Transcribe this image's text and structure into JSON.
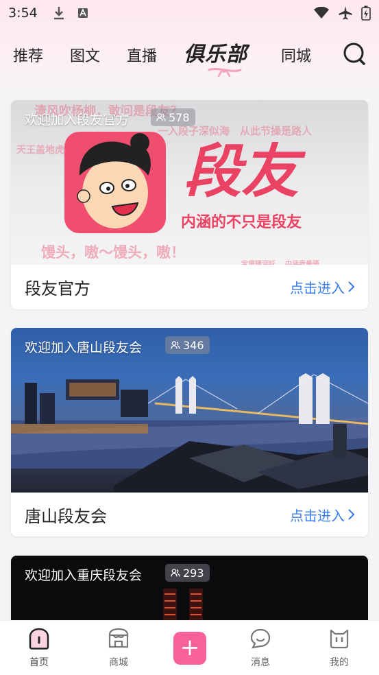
{
  "status_bar": {
    "time": "3:54"
  },
  "nav": {
    "tabs": [
      {
        "label": "推荐"
      },
      {
        "label": "图文"
      },
      {
        "label": "直播"
      },
      {
        "label": "俱乐部",
        "active": true
      },
      {
        "label": "同城"
      }
    ]
  },
  "clubs": [
    {
      "welcome": "欢迎加入段友官方",
      "members": "578",
      "name": "段友官方",
      "enter": "点击进入",
      "banner": {
        "logo_text": "段友",
        "slogan": "内涵的不只是段友",
        "bg_line_1": "清风吹杨柳，敢问是段友？",
        "bg_line_2": "一入段子深似海　从此节操是路人",
        "bg_line_3": "馒头，嗷～馒头，嗷！",
        "bg_line_4": "天王盖地虎",
        "bg_line_5": "宝塔镇河妖",
        "bg_line_6": "内涵我最骚"
      }
    },
    {
      "welcome": "欢迎加入唐山段友会",
      "members": "346",
      "name": "唐山段友会",
      "enter": "点击进入"
    },
    {
      "welcome": "欢迎加入重庆段友会",
      "members": "293"
    }
  ],
  "bottom_tabs": [
    {
      "label": "首页",
      "icon": "home-icon",
      "active": true
    },
    {
      "label": "商城",
      "icon": "shop-icon"
    },
    {
      "label": "消息",
      "icon": "message-icon"
    },
    {
      "label": "我的",
      "icon": "profile-icon"
    }
  ],
  "plus_button": {
    "label": "+"
  },
  "colors": {
    "accent": "#f9619b",
    "link": "#3a7de8",
    "logo_red": "#e94262"
  }
}
